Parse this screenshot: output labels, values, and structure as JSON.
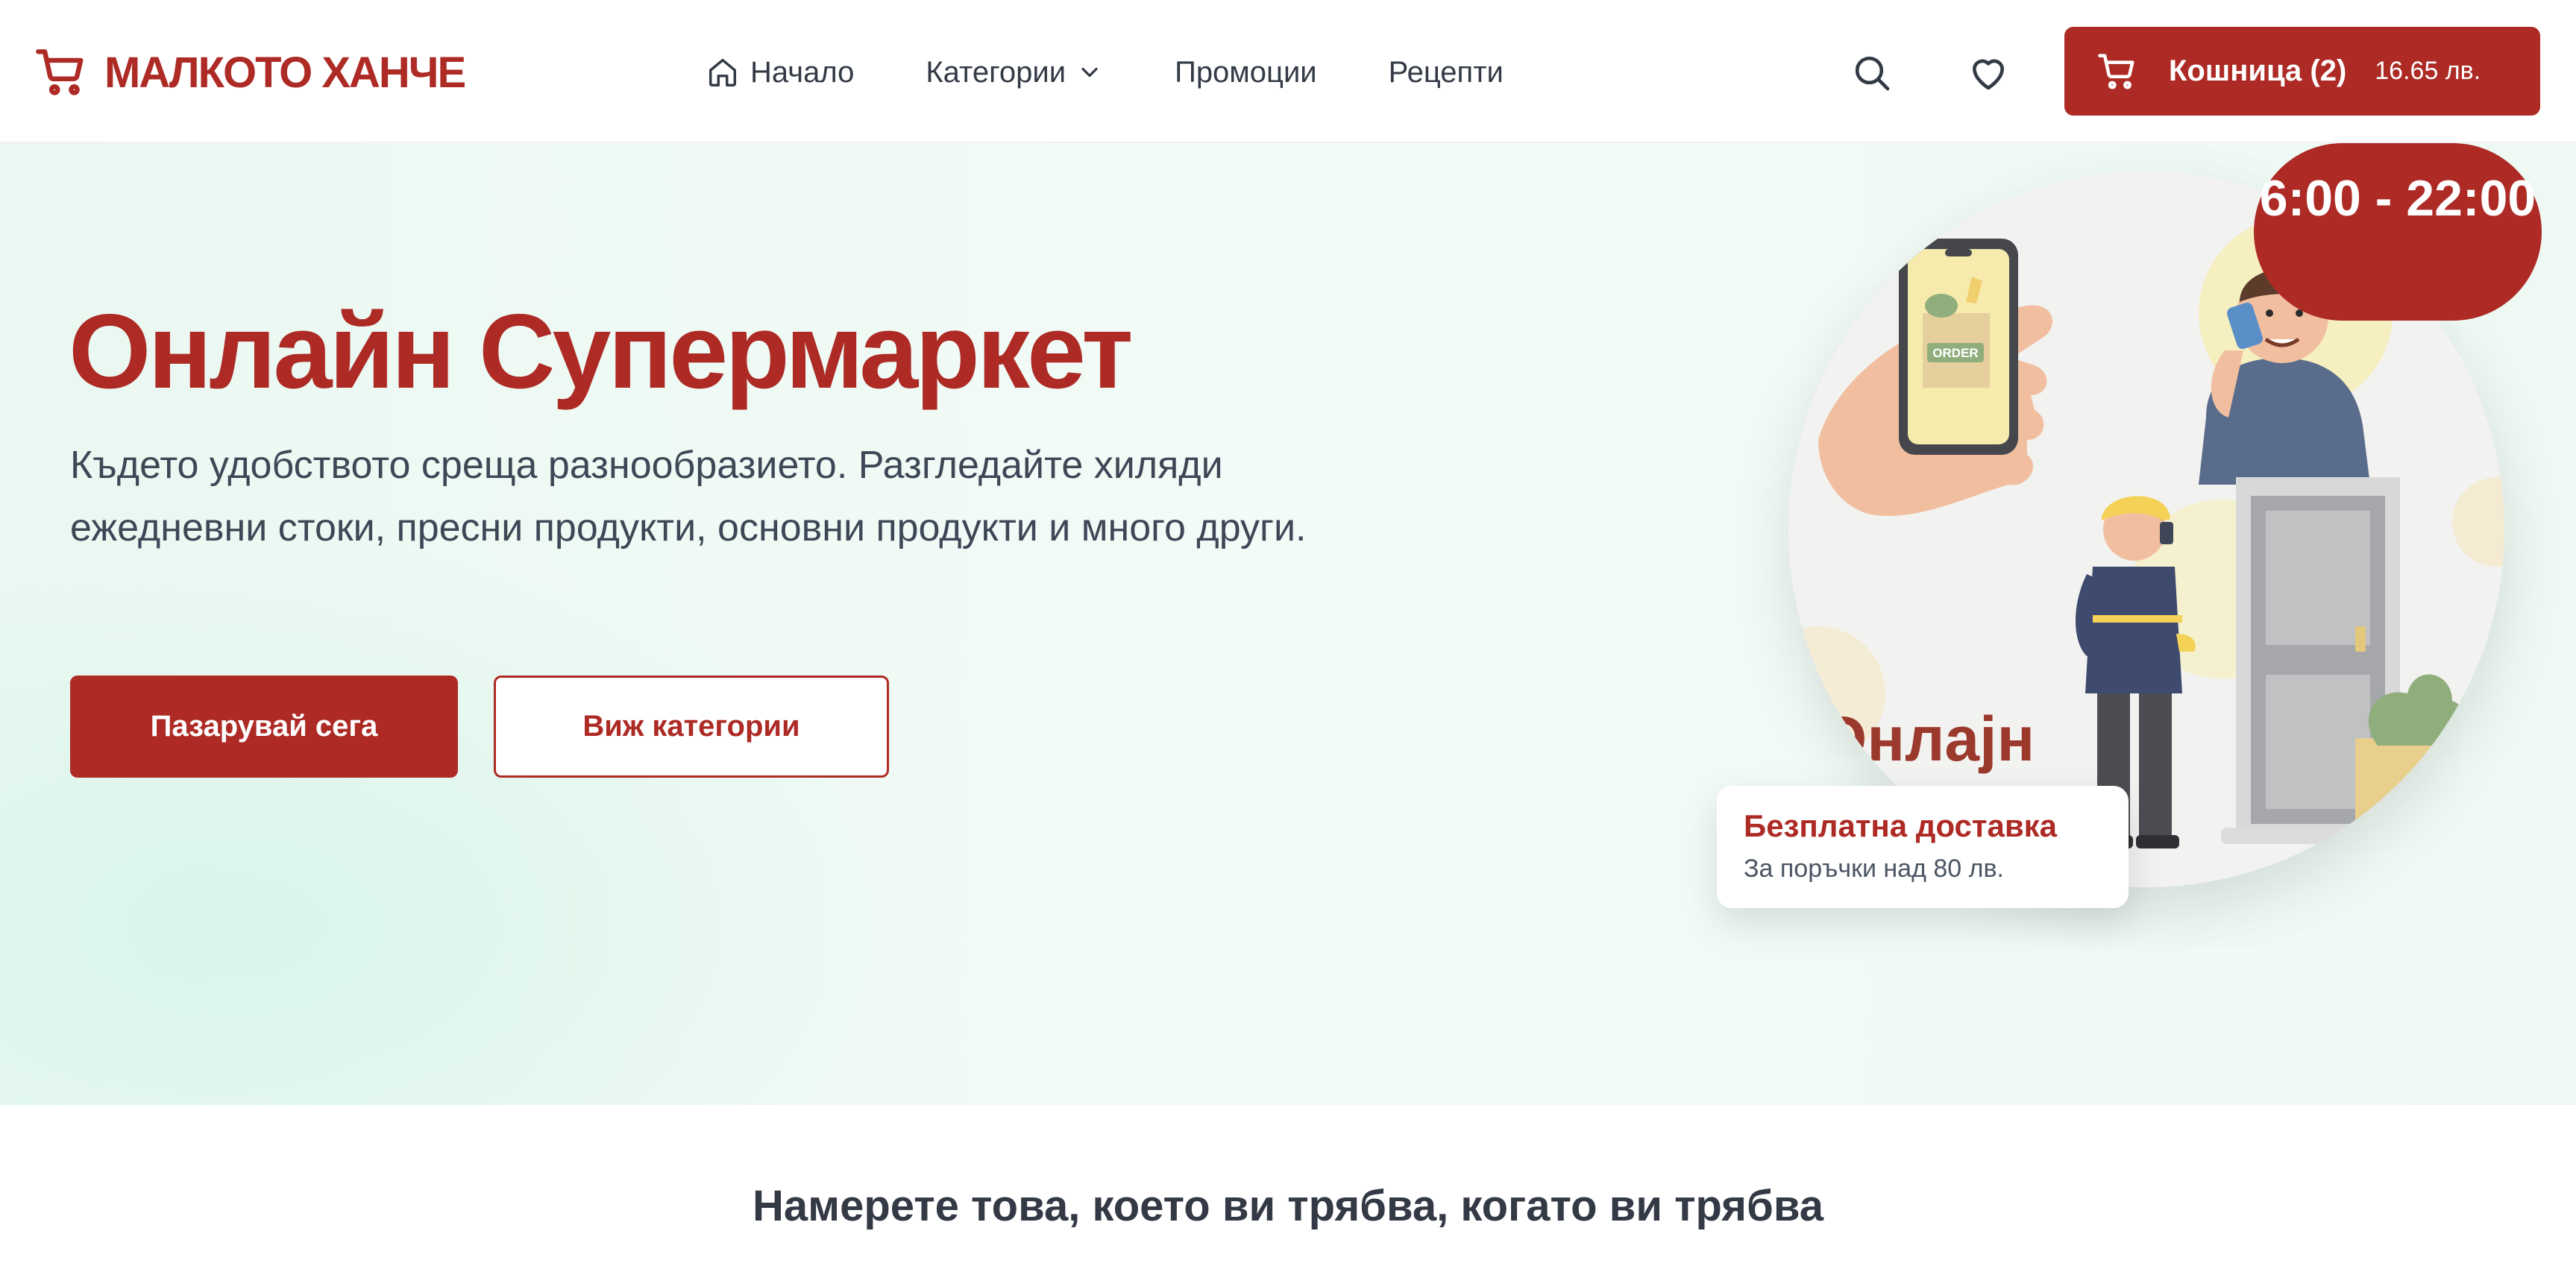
{
  "brand": {
    "name": "МАЛКОТО ХАНЧЕ",
    "color": "#ad2a25",
    "icon": "cart-icon"
  },
  "nav": {
    "items": [
      {
        "label": "Начало",
        "icon": "home-icon"
      },
      {
        "label": "Категории",
        "icon": "chevron-down-icon"
      },
      {
        "label": "Промоции"
      },
      {
        "label": "Рецепти"
      }
    ]
  },
  "header_actions": {
    "search_icon": "search-icon",
    "favorites_icon": "heart-icon"
  },
  "cart": {
    "label": "Кошница (2)",
    "total": "16.65 лв.",
    "icon": "cart-icon"
  },
  "hero": {
    "title": "Онлайн Супермаркет",
    "description": "Където удобството среща разнообразието. Разгледайте хиляди ежедневни стоки, пресни продукти, основни продукти и много други.",
    "primary_button": "Пазарувай сега",
    "secondary_button": "Виж категории",
    "hours": "6:00 - 22:00",
    "delivery_title": "Безплатна доставка",
    "delivery_subtitle": "За поръчки над 80 лв.",
    "illustration": {
      "phone_label": "ORDER",
      "caption_fragment": "Онлајн"
    }
  },
  "section": {
    "title": "Намерете това, което ви трябва, когато ви трябва"
  },
  "colors": {
    "accent": "#ad2a25",
    "text": "#333a46",
    "hero_bg": "#eaf8f1"
  }
}
